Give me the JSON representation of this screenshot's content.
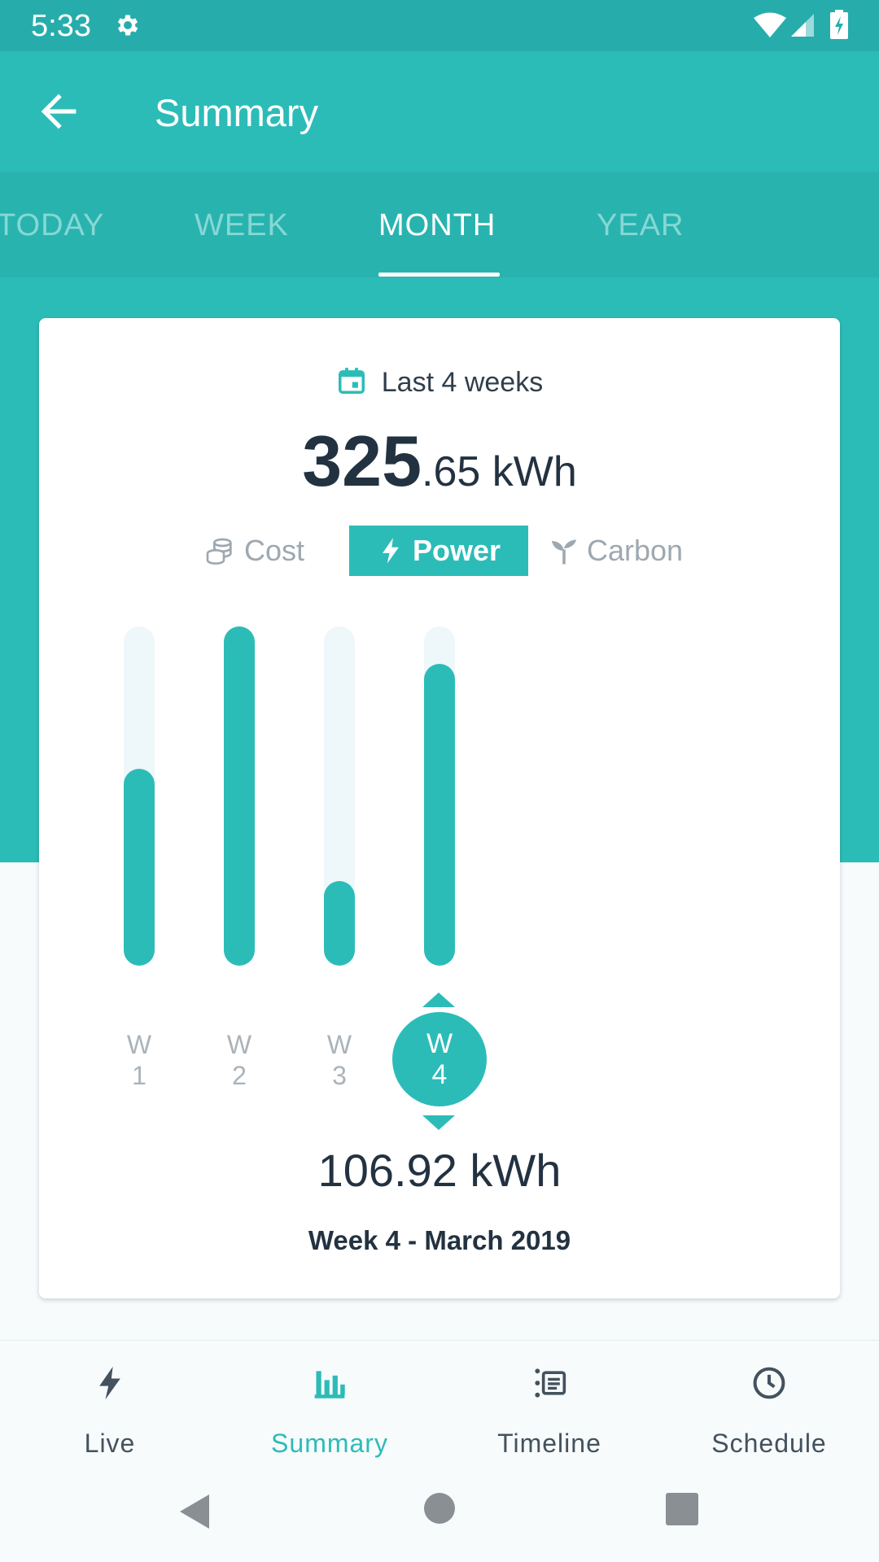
{
  "status_bar": {
    "time": "5:33"
  },
  "app_bar": {
    "title": "Summary"
  },
  "tabs": [
    {
      "label": "TODAY",
      "active": false
    },
    {
      "label": "WEEK",
      "active": false
    },
    {
      "label": "MONTH",
      "active": true
    },
    {
      "label": "YEAR",
      "active": false
    }
  ],
  "card": {
    "period_label": "Last 4 weeks",
    "total_integer": "325",
    "total_decimal": ".65 kWh",
    "metrics": [
      {
        "label": "Cost",
        "icon": "coins-icon",
        "active": false
      },
      {
        "label": "Power",
        "icon": "lightning-icon",
        "active": true
      },
      {
        "label": "Carbon",
        "icon": "sprout-icon",
        "active": false
      }
    ],
    "selected_value": "106.92 kWh",
    "selected_period": "Week 4 - March 2019"
  },
  "chart_data": {
    "type": "bar",
    "categories": [
      "W 1",
      "W 2",
      "W 3",
      "W 4"
    ],
    "category_lines": [
      [
        "W",
        "1"
      ],
      [
        "W",
        "2"
      ],
      [
        "W",
        "3"
      ],
      [
        "W",
        "4"
      ]
    ],
    "values": [
      0.58,
      1.0,
      0.25,
      0.89
    ],
    "selected_index": 3,
    "colors": {
      "fill": "#2cbcb8",
      "track": "#eef7f9"
    }
  },
  "bottom_nav": [
    {
      "label": "Live",
      "icon": "lightning-icon",
      "active": false
    },
    {
      "label": "Summary",
      "icon": "bar-chart-icon",
      "active": true
    },
    {
      "label": "Timeline",
      "icon": "timeline-icon",
      "active": false
    },
    {
      "label": "Schedule",
      "icon": "clock-icon",
      "active": false
    }
  ],
  "colors": {
    "primary": "#2cbcb8",
    "status_bar": "#26adab",
    "text_dark": "#233241",
    "text_muted": "#9ea8b0"
  }
}
